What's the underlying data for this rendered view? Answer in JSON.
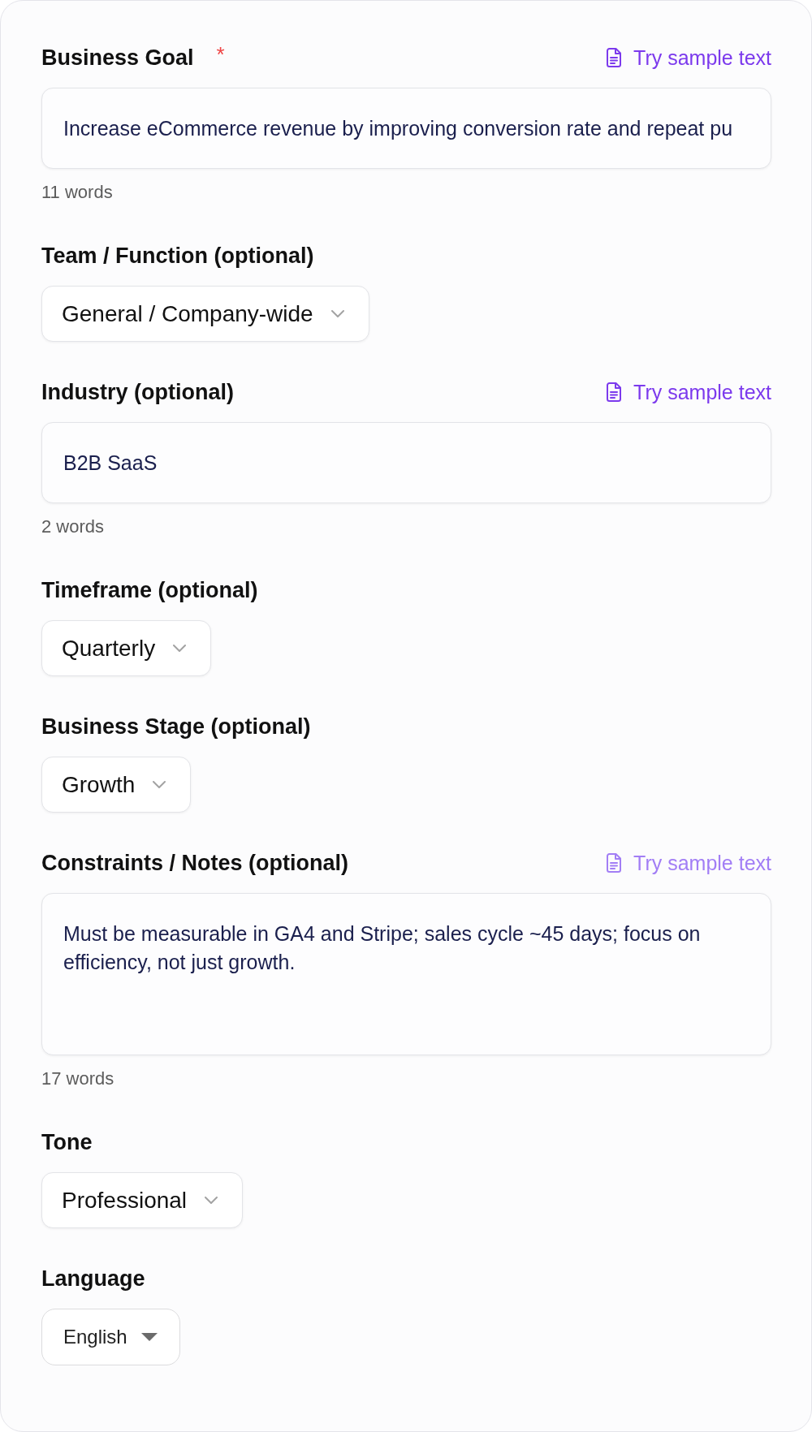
{
  "fields": [
    {
      "kind": "input",
      "label": "Business Goal",
      "required_mark": "*",
      "sample_link": {
        "label": "Try sample text",
        "disabled": false
      },
      "value": "Increase eCommerce revenue by improving conversion rate and repeat pu",
      "word_count": "11 words"
    },
    {
      "kind": "select",
      "label": "Team / Function (optional)",
      "value": "General / Company-wide"
    },
    {
      "kind": "input",
      "label": "Industry (optional)",
      "sample_link": {
        "label": "Try sample text",
        "disabled": false
      },
      "value": "B2B SaaS",
      "word_count": "2 words"
    },
    {
      "kind": "select",
      "label": "Timeframe (optional)",
      "value": "Quarterly"
    },
    {
      "kind": "select",
      "label": "Business Stage (optional)",
      "value": "Growth"
    },
    {
      "kind": "textarea",
      "label": "Constraints / Notes (optional)",
      "sample_link": {
        "label": "Try sample text",
        "disabled": true
      },
      "value": "Must be measurable in GA4 and Stripe; sales cycle ~45 days; focus on efficiency, not just growth.",
      "word_count": "17 words"
    },
    {
      "kind": "select",
      "label": "Tone",
      "value": "Professional"
    },
    {
      "kind": "native-select",
      "label": "Language",
      "value": "English"
    }
  ]
}
